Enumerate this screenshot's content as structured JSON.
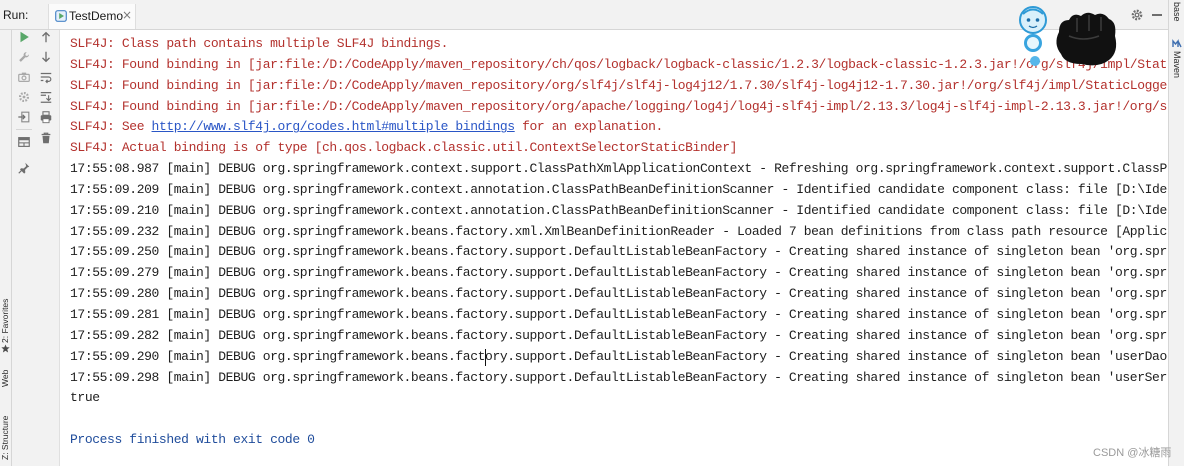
{
  "header": {
    "run_label": "Run:",
    "tab_label": "TestDemo",
    "tab_close": "×",
    "tab_icon": "run-config-icon",
    "actions": [
      "gear-icon",
      "minimize-icon"
    ]
  },
  "toolbar": {
    "primary": [
      "play-icon",
      "wrench-icon",
      "camera-icon",
      "settings-icon",
      "exit-icon",
      "layout-icon",
      "pin-icon"
    ],
    "secondary": [
      "up-arrow-icon",
      "down-arrow-icon",
      "soft-wrap-icon",
      "scroll-to-end-icon",
      "print-icon",
      "trash-icon"
    ]
  },
  "side_tabs": {
    "left": [
      {
        "label": "2: Favorites",
        "icon": "star-icon"
      },
      {
        "label": "Web"
      },
      {
        "label": "Z: Structure"
      }
    ],
    "right": [
      {
        "label": "base"
      },
      {
        "label": "Maven",
        "icon": "maven-icon"
      }
    ]
  },
  "console": {
    "lines": [
      {
        "kind": "stderr",
        "text": "SLF4J: Class path contains multiple SLF4J bindings."
      },
      {
        "kind": "stderr",
        "text": "SLF4J: Found binding in [jar:file:/D:/CodeApply/maven_repository/ch/qos/logback/logback-classic/1.2.3/logback-classic-1.2.3.jar!/org/slf4j/impl/Stat"
      },
      {
        "kind": "stderr",
        "text": "SLF4J: Found binding in [jar:file:/D:/CodeApply/maven_repository/org/slf4j/slf4j-log4j12/1.7.30/slf4j-log4j12-1.7.30.jar!/org/slf4j/impl/StaticLogge"
      },
      {
        "kind": "stderr",
        "text": "SLF4J: Found binding in [jar:file:/D:/CodeApply/maven_repository/org/apache/logging/log4j/log4j-slf4j-impl/2.13.3/log4j-slf4j-impl-2.13.3.jar!/org/s"
      },
      {
        "kind": "stderr",
        "segments": [
          {
            "kind": "stderr",
            "text": "SLF4J: See "
          },
          {
            "kind": "link",
            "text": "http://www.slf4j.org/codes.html#multiple_bindings"
          },
          {
            "kind": "stderr",
            "text": " for an explanation."
          }
        ]
      },
      {
        "kind": "stderr",
        "text": "SLF4J: Actual binding is of type [ch.qos.logback.classic.util.ContextSelectorStaticBinder]"
      },
      {
        "kind": "stdout",
        "text": "17:55:08.987 [main] DEBUG org.springframework.context.support.ClassPathXmlApplicationContext - Refreshing org.springframework.context.support.ClassP"
      },
      {
        "kind": "stdout",
        "text": "17:55:09.209 [main] DEBUG org.springframework.context.annotation.ClassPathBeanDefinitionScanner - Identified candidate component class: file [D:\\Ide"
      },
      {
        "kind": "stdout",
        "text": "17:55:09.210 [main] DEBUG org.springframework.context.annotation.ClassPathBeanDefinitionScanner - Identified candidate component class: file [D:\\Ide"
      },
      {
        "kind": "stdout",
        "text": "17:55:09.232 [main] DEBUG org.springframework.beans.factory.xml.XmlBeanDefinitionReader - Loaded 7 bean definitions from class path resource [Applic"
      },
      {
        "kind": "stdout",
        "text": "17:55:09.250 [main] DEBUG org.springframework.beans.factory.support.DefaultListableBeanFactory - Creating shared instance of singleton bean 'org.spr"
      },
      {
        "kind": "stdout",
        "text": "17:55:09.279 [main] DEBUG org.springframework.beans.factory.support.DefaultListableBeanFactory - Creating shared instance of singleton bean 'org.spr"
      },
      {
        "kind": "stdout",
        "text": "17:55:09.280 [main] DEBUG org.springframework.beans.factory.support.DefaultListableBeanFactory - Creating shared instance of singleton bean 'org.spr"
      },
      {
        "kind": "stdout",
        "text": "17:55:09.281 [main] DEBUG org.springframework.beans.factory.support.DefaultListableBeanFactory - Creating shared instance of singleton bean 'org.spr"
      },
      {
        "kind": "stdout",
        "text": "17:55:09.282 [main] DEBUG org.springframework.beans.factory.support.DefaultListableBeanFactory - Creating shared instance of singleton bean 'org.spr"
      },
      {
        "kind": "stdout",
        "text": "17:55:09.290 [main] DEBUG org.springframework.beans.factory.support.DefaultListableBeanFactory - Creating shared instance of singleton bean 'userDao"
      },
      {
        "kind": "stdout",
        "text": "17:55:09.298 [main] DEBUG org.springframework.beans.factory.support.DefaultListableBeanFactory - Creating shared instance of singleton bean 'userSer"
      },
      {
        "kind": "stdout",
        "text": "true"
      }
    ],
    "exit_message": "Process finished with exit code 0"
  },
  "overlay": {
    "icons": [
      "cartoon-face-icon",
      "ring-icon",
      "dot-icon",
      "black-fist-icon"
    ]
  },
  "watermark": "CSDN @冰糖雨",
  "colors": {
    "stderr": "#b3312d",
    "stdout": "#1e1e1e",
    "link": "#2a56c6",
    "exit": "#1f4c9b",
    "run": "#59a869"
  }
}
